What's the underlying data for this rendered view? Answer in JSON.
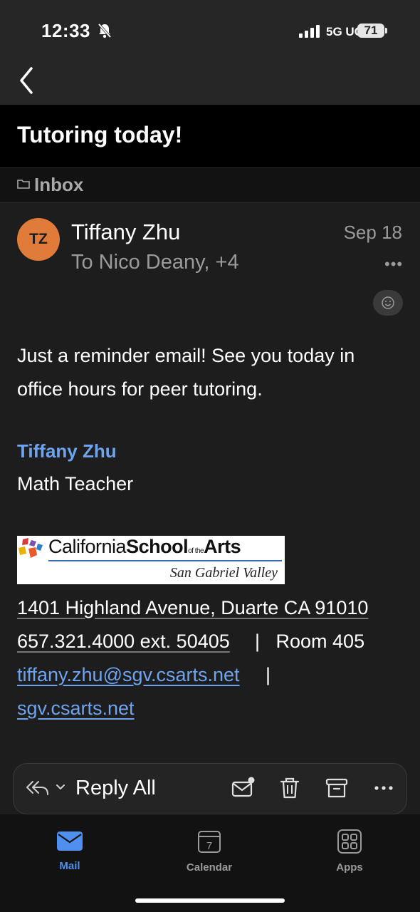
{
  "status_bar": {
    "time": "12:33",
    "network": "5G UC",
    "battery": "71"
  },
  "nav": {
    "back_icon": "chevron-left-icon"
  },
  "email": {
    "subject": "Tutoring today!",
    "folder": "Inbox",
    "avatar_initials": "TZ",
    "sender": "Tiffany Zhu",
    "recipients": "To Nico Deany, +4",
    "date": "Sep 18",
    "more": "•••",
    "body": "Just a reminder email! See you today in office hours for peer tutoring.",
    "signature": {
      "name": "Tiffany Zhu",
      "title": "Math Teacher",
      "logo_text_1": "California",
      "logo_text_2": "School",
      "logo_text_3": "of the",
      "logo_text_4": "Arts",
      "logo_sub": "San Gabriel Valley",
      "address": "1401 Highland Avenue, Duarte CA 91010",
      "phone": "657.321.4000 ext. 50405",
      "room": "|   Room 405",
      "email": "tiffany.zhu@sgv.csarts.net",
      "separator": "|",
      "website": "sgv.csarts.net"
    }
  },
  "toolbar": {
    "reply_label": "Reply All",
    "icons": [
      "reply-all-icon",
      "mark-unread-icon",
      "trash-icon",
      "archive-icon",
      "more-icon"
    ]
  },
  "tabs": [
    {
      "label": "Mail",
      "icon": "mail-icon",
      "active": true
    },
    {
      "label": "Calendar",
      "icon": "calendar-icon",
      "day": "7",
      "active": false
    },
    {
      "label": "Apps",
      "icon": "apps-icon",
      "active": false
    }
  ],
  "colors": {
    "accent": "#4e8ff0",
    "avatar": "#e07b39",
    "link": "#6ea4ef"
  }
}
